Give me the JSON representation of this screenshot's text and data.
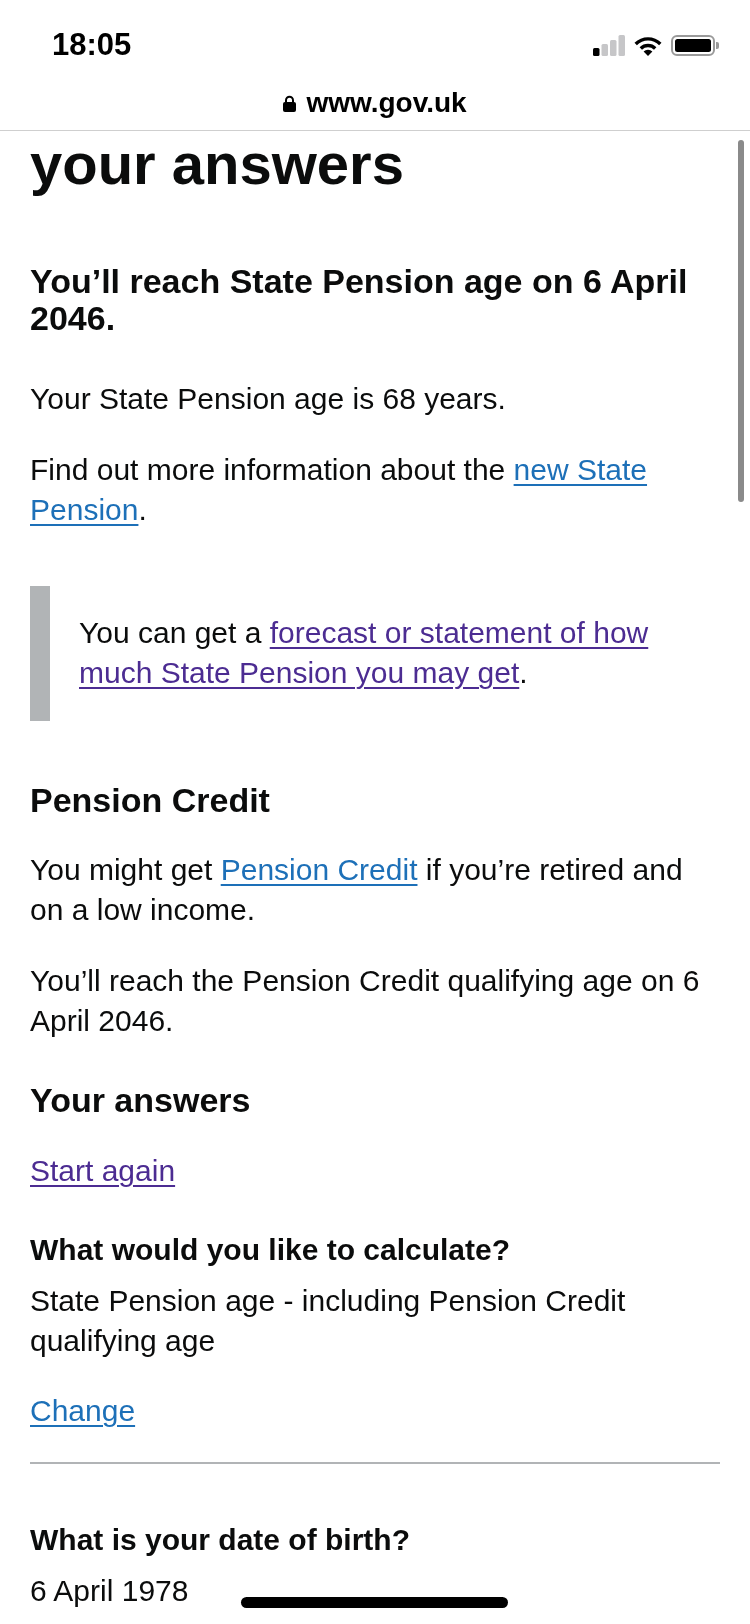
{
  "status_bar": {
    "time": "18:05"
  },
  "address_bar": {
    "url": "www.gov.uk"
  },
  "page": {
    "title": "your answers",
    "result": {
      "heading": "You’ll reach State Pension age on 6 April 2046.",
      "paragraphs": [
        [
          {
            "kind": "text",
            "text": "Your State Pension age is 68 years."
          }
        ],
        [
          {
            "kind": "text",
            "text": "Find out more information about the "
          },
          {
            "kind": "link",
            "text": "new State Pension",
            "visited": false
          },
          {
            "kind": "text",
            "text": "."
          }
        ]
      ],
      "inset": [
        {
          "kind": "text",
          "text": "You can get a "
        },
        {
          "kind": "link",
          "text": "forecast or statement of how much State Pension you may get",
          "visited": true
        },
        {
          "kind": "text",
          "text": "."
        }
      ]
    },
    "pension_credit": {
      "heading": "Pension Credit",
      "paragraphs": [
        [
          {
            "kind": "text",
            "text": "You might get "
          },
          {
            "kind": "link",
            "text": "Pension Credit",
            "visited": false
          },
          {
            "kind": "text",
            "text": " if you’re retired and on a low income."
          }
        ],
        [
          {
            "kind": "text",
            "text": "You’ll reach the Pension Credit qualifying age on 6 April 2046."
          }
        ]
      ]
    },
    "answers": {
      "heading": "Your answers",
      "start_again": {
        "text": "Start again",
        "visited": true
      },
      "items": [
        {
          "question": "What would you like to calculate?",
          "answer": "State Pension age - including Pension Credit qualifying age",
          "change": {
            "text": "Change",
            "visited": false
          }
        },
        {
          "question": "What is your date of birth?",
          "answer": "6 April 1978"
        }
      ]
    }
  }
}
